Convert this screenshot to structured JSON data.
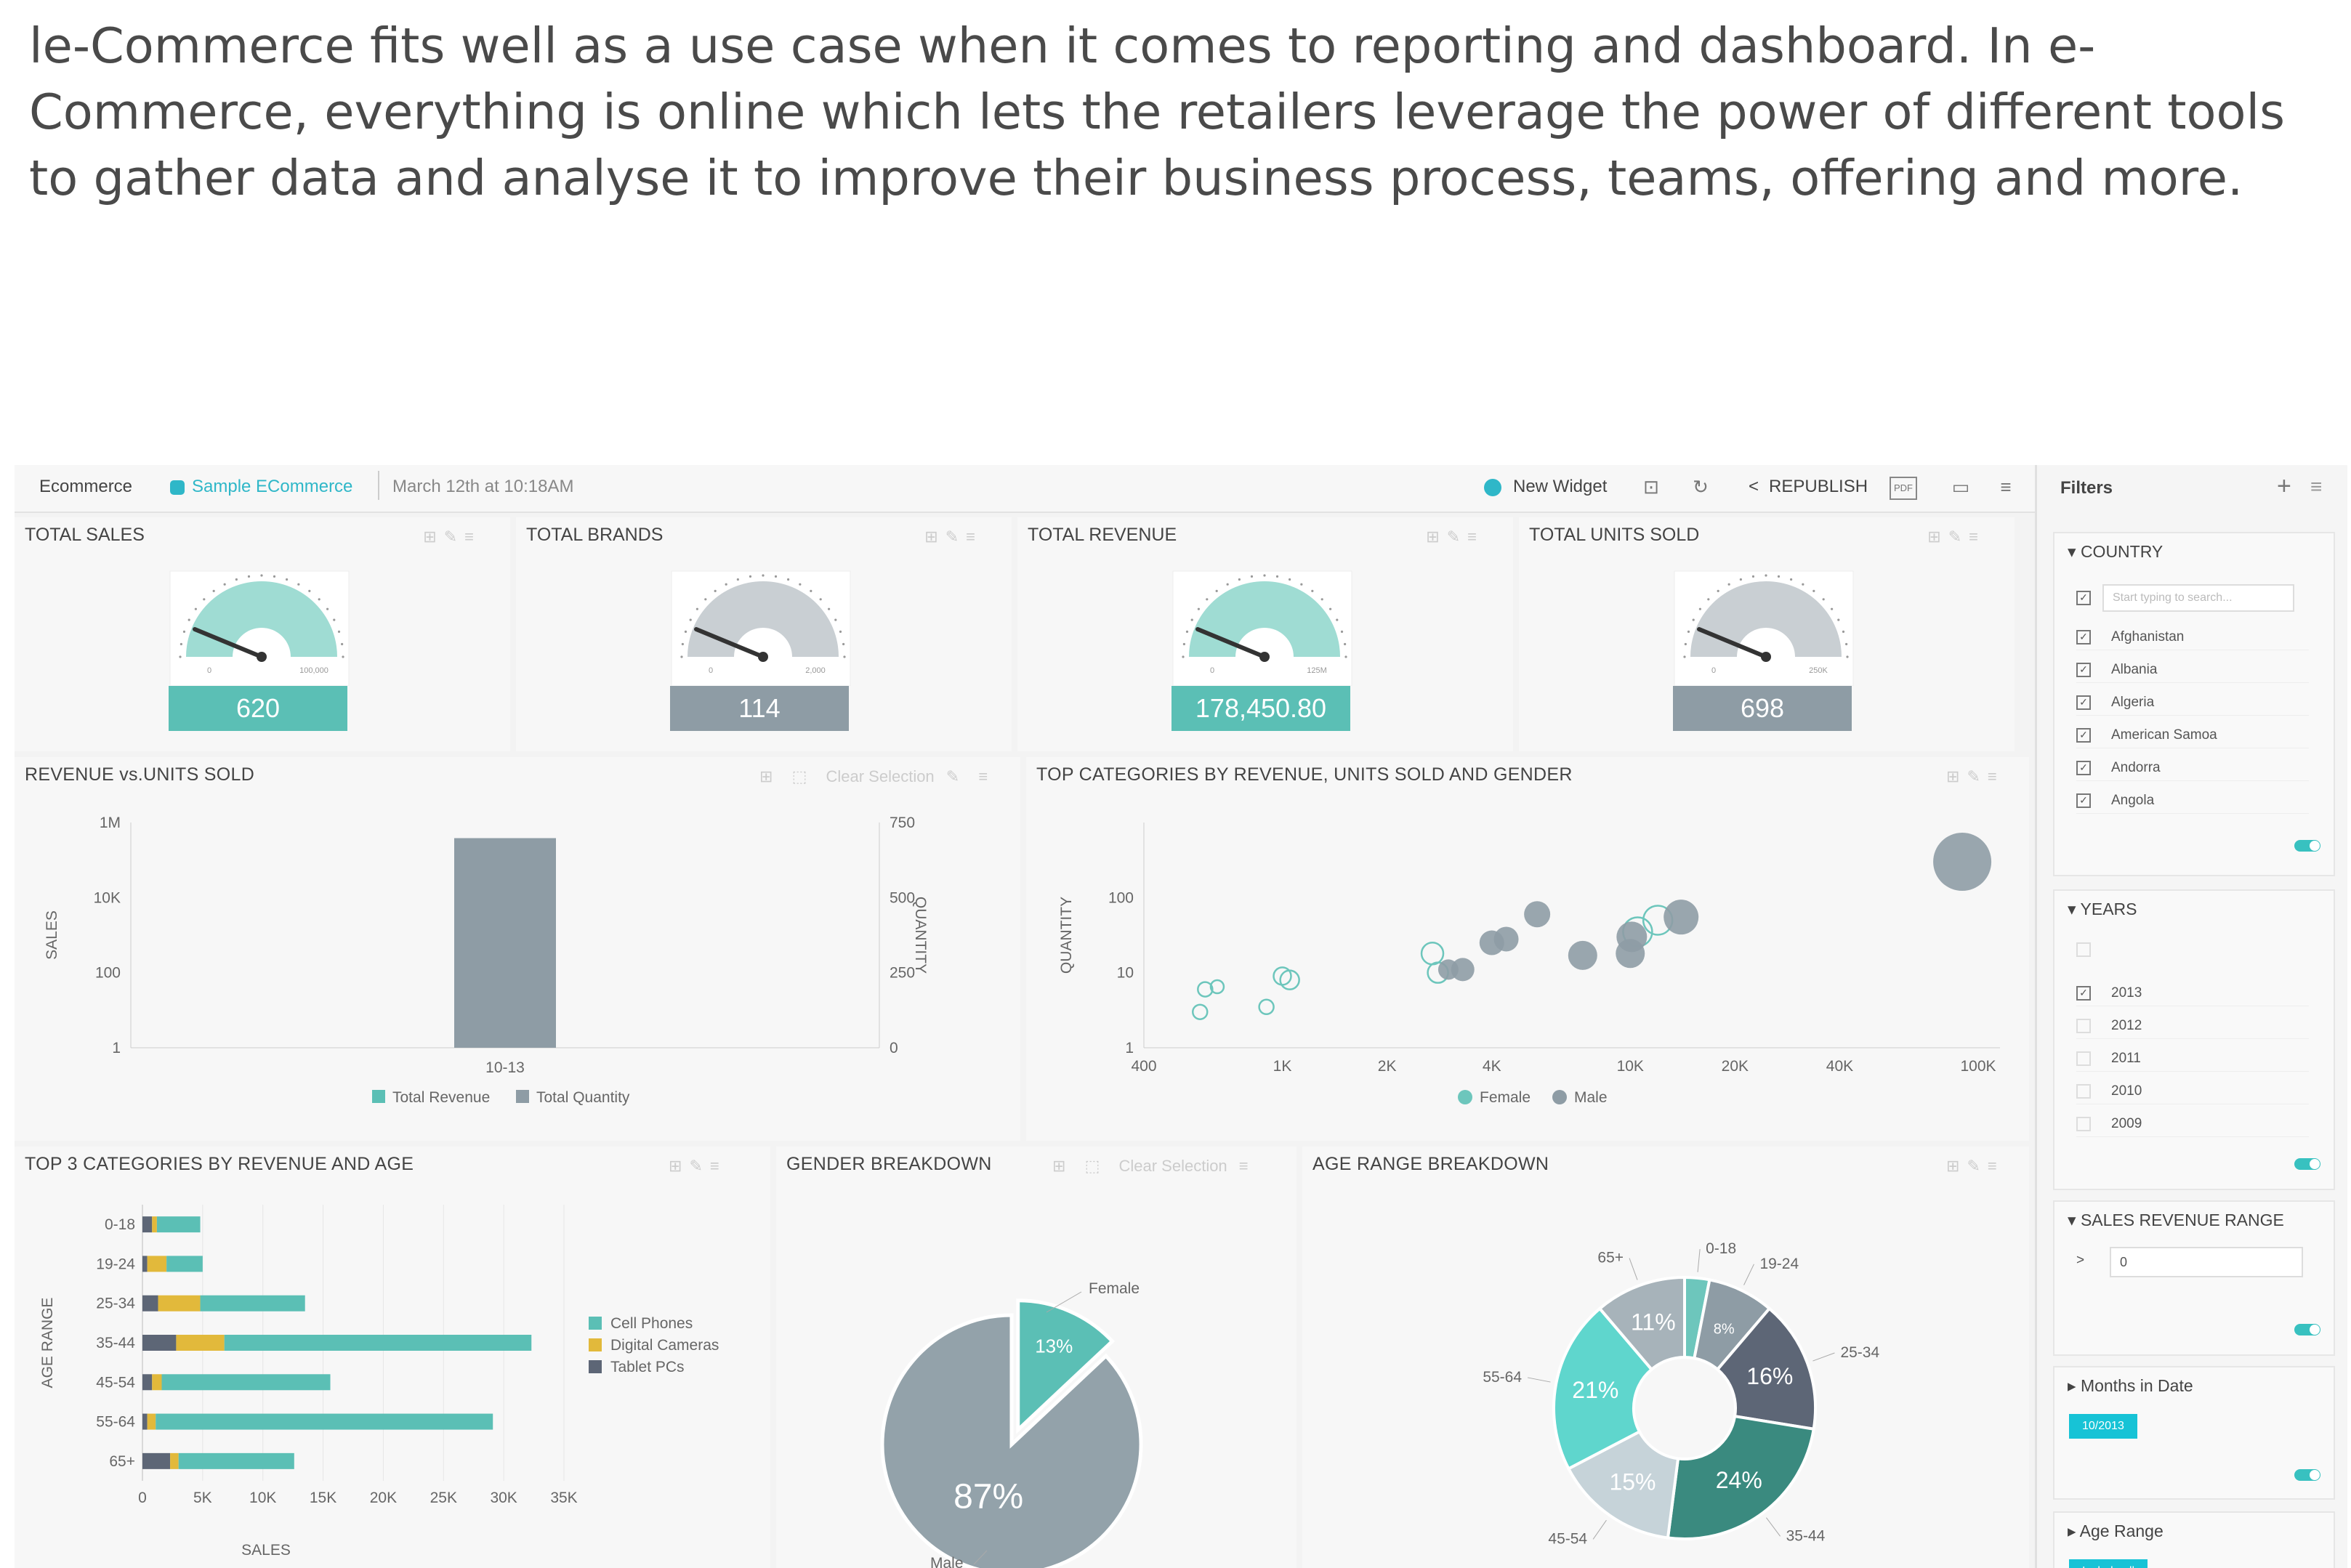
{
  "intro_text": "le-Commerce fits well as a use case when it comes to reporting and dashboard. In e-Commerce, everything is online which lets the retailers leverage the power of different tools to gather data and analyse it to improve their business process, teams, offering and more.",
  "topbar": {
    "app_name": "Ecommerce",
    "dashboard_name": "Sample ECommerce",
    "timestamp": "March 12th at 10:18AM",
    "new_widget": "New Widget",
    "republish": "REPUBLISH",
    "pdf": "PDF"
  },
  "kpis": [
    {
      "title": "TOTAL SALES",
      "value": "620",
      "min": "0",
      "max": "100,000",
      "color": "#5bbfb5"
    },
    {
      "title": "TOTAL BRANDS",
      "value": "114",
      "min": "0",
      "max": "2,000",
      "color": "#8e9ca5"
    },
    {
      "title": "TOTAL REVENUE",
      "value": "178,450.80",
      "min": "0",
      "max": "125M",
      "color": "#5bbfb5"
    },
    {
      "title": "TOTAL UNITS SOLD",
      "value": "698",
      "min": "0",
      "max": "250K",
      "color": "#8e9ca5"
    }
  ],
  "revenue_widget": {
    "title": "REVENUE vs.UNITS SOLD",
    "clear": "Clear Selection",
    "legend": [
      "Total Revenue",
      "Total Quantity"
    ]
  },
  "scatter_widget": {
    "title": "TOP CATEGORIES BY REVENUE, UNITS SOLD AND GENDER",
    "legend": [
      "Female",
      "Male"
    ]
  },
  "top3_widget": {
    "title": "TOP 3 CATEGORIES BY REVENUE AND AGE",
    "legend": [
      "Cell Phones",
      "Digital Cameras",
      "Tablet PCs"
    ]
  },
  "gender_widget": {
    "title": "GENDER BREAKDOWN",
    "clear": "Clear Selection"
  },
  "age_widget": {
    "title": "AGE RANGE BREAKDOWN"
  },
  "filters": {
    "title": "Filters",
    "country": {
      "title": "COUNTRY",
      "search_placeholder": "Start typing to search...",
      "items": [
        "Afghanistan",
        "Albania",
        "Algeria",
        "American Samoa",
        "Andorra",
        "Angola"
      ]
    },
    "years": {
      "title": "YEARS",
      "items": [
        {
          "label": "2013",
          "checked": true
        },
        {
          "label": "2012",
          "checked": false
        },
        {
          "label": "2011",
          "checked": false
        },
        {
          "label": "2010",
          "checked": false
        },
        {
          "label": "2009",
          "checked": false
        }
      ]
    },
    "sales_range": {
      "title": "SALES REVENUE RANGE",
      "operator": ">",
      "value": "0"
    },
    "months": {
      "title": "Months in Date",
      "tag": "10/2013"
    },
    "age_range": {
      "title": "Age Range",
      "tag": "Include all"
    }
  },
  "chart_data": [
    {
      "type": "bar",
      "title": "REVENUE vs.UNITS SOLD",
      "categories": [
        "10-13"
      ],
      "xlabel": "",
      "ylabel": "SALES",
      "y2label": "QUANTITY",
      "y_scale": "log",
      "y_ticks": [
        "1",
        "100",
        "10K",
        "1M"
      ],
      "y2_ticks": [
        "0",
        "250",
        "500",
        "750"
      ],
      "series": [
        {
          "name": "Total Revenue",
          "values": [
            178450.8
          ],
          "color": "#5bbfb5"
        },
        {
          "name": "Total Quantity",
          "values": [
            698
          ],
          "color": "#8e9ca5"
        }
      ]
    },
    {
      "type": "scatter",
      "title": "TOP CATEGORIES BY REVENUE, UNITS SOLD AND GENDER",
      "xlabel": "",
      "ylabel": "QUANTITY",
      "x_scale": "log",
      "y_scale": "log",
      "x_ticks": [
        "400",
        "1K",
        "2K",
        "4K",
        "10K",
        "20K",
        "40K",
        "100K"
      ],
      "y_ticks": [
        "1",
        "10",
        "100"
      ],
      "series": [
        {
          "name": "Female",
          "color": "#6dc6bc",
          "points": [
            {
              "x": 600,
              "y": 6,
              "s": 10
            },
            {
              "x": 650,
              "y": 6.5,
              "s": 9
            },
            {
              "x": 580,
              "y": 3,
              "s": 10
            },
            {
              "x": 900,
              "y": 3.5,
              "s": 10
            },
            {
              "x": 1000,
              "y": 9,
              "s": 12
            },
            {
              "x": 1050,
              "y": 8,
              "s": 13
            },
            {
              "x": 2700,
              "y": 18,
              "s": 15
            },
            {
              "x": 2800,
              "y": 10,
              "s": 14
            },
            {
              "x": 10500,
              "y": 35,
              "s": 20
            },
            {
              "x": 12000,
              "y": 50,
              "s": 20
            }
          ]
        },
        {
          "name": "Male",
          "color": "#8e9ca5",
          "points": [
            {
              "x": 3000,
              "y": 11,
              "s": 14
            },
            {
              "x": 3300,
              "y": 11,
              "s": 16
            },
            {
              "x": 4000,
              "y": 25,
              "s": 17
            },
            {
              "x": 4400,
              "y": 28,
              "s": 17
            },
            {
              "x": 5400,
              "y": 60,
              "s": 18
            },
            {
              "x": 7300,
              "y": 17,
              "s": 20
            },
            {
              "x": 10000,
              "y": 18,
              "s": 20
            },
            {
              "x": 10100,
              "y": 30,
              "s": 21
            },
            {
              "x": 14000,
              "y": 55,
              "s": 24
            },
            {
              "x": 90000,
              "y": 300,
              "s": 40
            }
          ]
        }
      ]
    },
    {
      "type": "bar",
      "orientation": "horizontal",
      "stacked": true,
      "title": "TOP 3 CATEGORIES BY REVENUE AND AGE",
      "xlabel": "SALES",
      "ylabel": "AGE RANGE",
      "categories": [
        "0-18",
        "19-24",
        "25-34",
        "35-44",
        "45-54",
        "55-64",
        "65+"
      ],
      "x_ticks": [
        "0",
        "5K",
        "10K",
        "15K",
        "20K",
        "25K",
        "30K",
        "35K"
      ],
      "xlim": [
        0,
        35000
      ],
      "series": [
        {
          "name": "Tablet PCs",
          "color": "#5d6676",
          "values": [
            800,
            400,
            1300,
            2800,
            800,
            400,
            2300
          ]
        },
        {
          "name": "Digital Cameras",
          "color": "#e2b93b",
          "values": [
            400,
            1600,
            3500,
            4000,
            800,
            700,
            700
          ]
        },
        {
          "name": "Cell Phones",
          "color": "#5bbfb5",
          "values": [
            3600,
            3000,
            8700,
            25500,
            14000,
            28000,
            9600
          ]
        }
      ]
    },
    {
      "type": "pie",
      "title": "GENDER BREAKDOWN",
      "labels": [
        "Female",
        "Male"
      ],
      "values": [
        13,
        87
      ],
      "value_labels": [
        "13%",
        "87%"
      ],
      "colors": [
        "#5bbfb5",
        "#93a2aa"
      ]
    },
    {
      "type": "pie",
      "donut": true,
      "title": "AGE RANGE BREAKDOWN",
      "labels": [
        "0-18",
        "19-24",
        "25-34",
        "35-44",
        "45-54",
        "55-64",
        "65+"
      ],
      "values": [
        3,
        8,
        16,
        24,
        15,
        21,
        11
      ],
      "value_labels": [
        "",
        "8%",
        "16%",
        "24%",
        "15%",
        "21%",
        "11%"
      ],
      "colors": [
        "#6dc6bc",
        "#8e9ca5",
        "#5d6676",
        "#3a8a7f",
        "#c6d3d9",
        "#5fd6cd",
        "#a7b3ba"
      ]
    }
  ]
}
